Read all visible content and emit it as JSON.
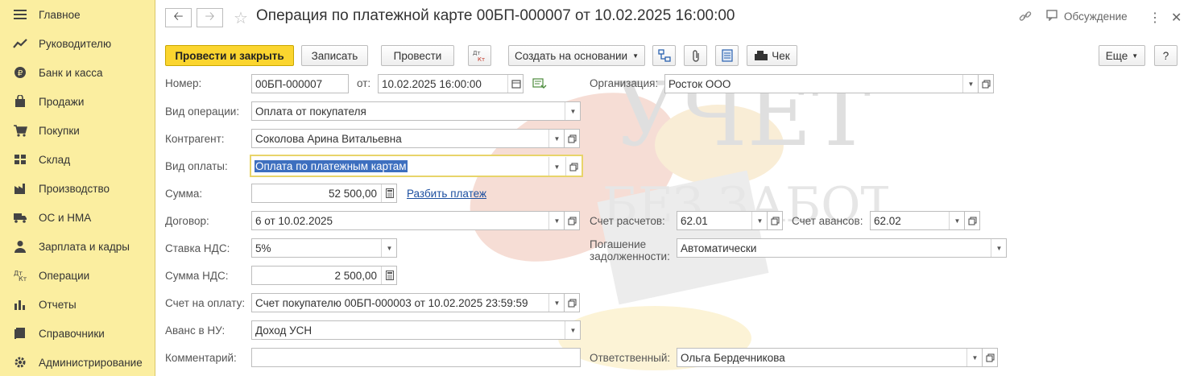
{
  "sidebar": {
    "items": [
      {
        "label": "Главное",
        "icon": "menu-icon"
      },
      {
        "label": "Руководителю",
        "icon": "trend-icon"
      },
      {
        "label": "Банк и касса",
        "icon": "coin-icon"
      },
      {
        "label": "Продажи",
        "icon": "bag-icon"
      },
      {
        "label": "Покупки",
        "icon": "cart-icon"
      },
      {
        "label": "Склад",
        "icon": "warehouse-icon"
      },
      {
        "label": "Производство",
        "icon": "factory-icon"
      },
      {
        "label": "ОС и НМА",
        "icon": "truck-icon"
      },
      {
        "label": "Зарплата и кадры",
        "icon": "person-icon"
      },
      {
        "label": "Операции",
        "icon": "dt-kt-icon"
      },
      {
        "label": "Отчеты",
        "icon": "bar-chart-icon"
      },
      {
        "label": "Справочники",
        "icon": "book-icon"
      },
      {
        "label": "Администрирование",
        "icon": "gear-icon"
      }
    ]
  },
  "header": {
    "title": "Операция по платежной карте 00БП-000007 от 10.02.2025 16:00:00",
    "discussion_label": "Обсуждение"
  },
  "toolbar": {
    "post_close": "Провести и закрыть",
    "save": "Записать",
    "post": "Провести",
    "dtkt_label": "Дт Кт",
    "create_based": "Создать на основании",
    "check": "Чек",
    "more": "Еще",
    "help": "?"
  },
  "form": {
    "number_label": "Номер:",
    "number_value": "00БП-000007",
    "date_label": "от:",
    "date_value": "10.02.2025 16:00:00",
    "org_label": "Организация:",
    "org_value": "Росток ООО",
    "op_type_label": "Вид операции:",
    "op_type_value": "Оплата от покупателя",
    "counterparty_label": "Контрагент:",
    "counterparty_value": "Соколова Арина Витальевна",
    "payment_type_label": "Вид оплаты:",
    "payment_type_value": "Оплата по платежным картам",
    "amount_label": "Сумма:",
    "amount_value": "52 500,00",
    "split_link": "Разбить платеж",
    "contract_label": "Договор:",
    "contract_value": "6 от 10.02.2025",
    "settle_acc_label": "Счет расчетов:",
    "settle_acc_value": "62.01",
    "advance_acc_label": "Счет авансов:",
    "advance_acc_value": "62.02",
    "vat_rate_label": "Ставка НДС:",
    "vat_rate_value": "5%",
    "debt_label_1": "Погашение",
    "debt_label_2": "задолженности:",
    "debt_value": "Автоматически",
    "vat_sum_label": "Сумма НДС:",
    "vat_sum_value": "2 500,00",
    "invoice_label": "Счет на оплату:",
    "invoice_value": "Счет покупателю 00БП-000003 от 10.02.2025 23:59:59",
    "advance_nu_label": "Аванс в НУ:",
    "advance_nu_value": "Доход УСН",
    "comment_label": "Комментарий:",
    "comment_value": "",
    "responsible_label": "Ответственный:",
    "responsible_value": "Ольга Бердечникова"
  },
  "watermark": {
    "line1": "УЧЕТ",
    "line2": "БЕЗ ЗАБОТ"
  }
}
